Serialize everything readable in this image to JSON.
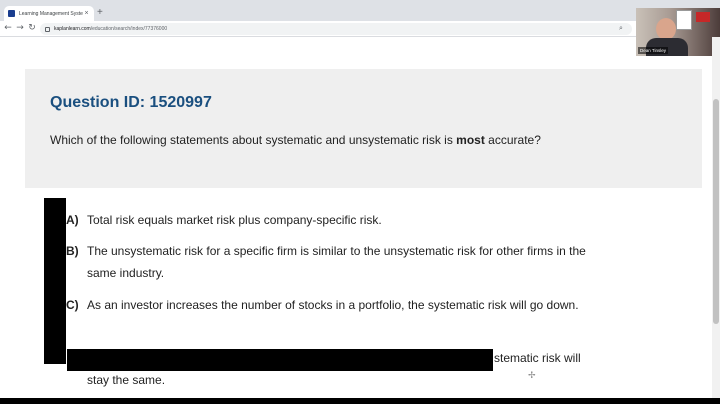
{
  "browser": {
    "tab_title": "Learning Management System",
    "tab_close": "×",
    "new_tab": "+",
    "back": "←",
    "forward": "→",
    "reload": "↻",
    "url_domain": "kaplanlearn.com",
    "url_path": "/education/search/index/77376000",
    "search_icon": "⌕",
    "bookmark_icon": "☆"
  },
  "webcam": {
    "name_tag": "Dean Tinsley"
  },
  "question": {
    "id_label": "Question ID: 1520997",
    "text_before": "Which of the following statements about systematic and unsystematic risk is ",
    "text_bold": "most",
    "text_after": " accurate?"
  },
  "choices": [
    {
      "letter": "A)",
      "text": "Total risk equals market risk plus company-specific risk."
    },
    {
      "letter": "B)",
      "text": "The unsystematic risk for a specific firm is similar to the unsystematic risk for other firms in the same industry."
    },
    {
      "letter": "C)",
      "text": "As an investor increases the number of stocks in a portfolio, the systematic risk will go down."
    }
  ],
  "choice_d_partial": {
    "line1_visible": "stematic risk will",
    "line2": "stay the same."
  },
  "colors": {
    "question_id": "#1a4f7f",
    "card_bg": "#efefef",
    "redaction": "#000000"
  }
}
